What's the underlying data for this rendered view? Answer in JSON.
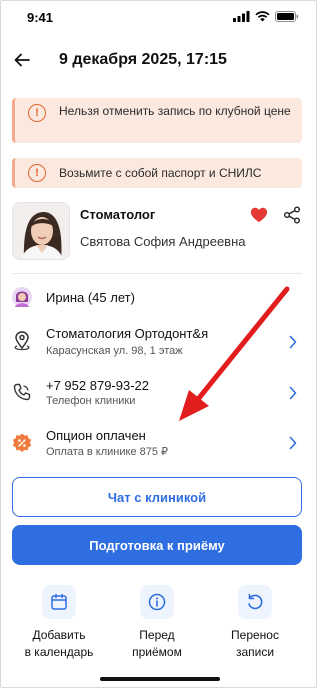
{
  "status_bar": {
    "time": "9:41"
  },
  "header": {
    "title": "9 декабря 2025, 17:15"
  },
  "notices": [
    {
      "text": "Нельзя отменить запись по клубной цене"
    },
    {
      "text": "Возьмите с собой паспорт и СНИЛС"
    }
  ],
  "doctor": {
    "specialty": "Стоматолог",
    "name": "Святова София Андреевна",
    "favorited": true
  },
  "patient": {
    "label": "Ирина (45 лет)"
  },
  "clinic": {
    "name": "Стоматология Ортодонт&я",
    "address": "Карасунская ул. 98, 1 этаж"
  },
  "phone": {
    "number": "+7 952 879-93-22",
    "caption": "Телефон клиники"
  },
  "option": {
    "title": "Опцион оплачен",
    "caption": "Оплата в клинике 875 ₽"
  },
  "buttons": {
    "chat": "Чат с клиникой",
    "prepare": "Подготовка к приёму"
  },
  "actions": [
    {
      "label": "Добавить\nв календарь",
      "icon": "calendar-icon"
    },
    {
      "label": "Перед\nприёмом",
      "icon": "info-icon"
    },
    {
      "label": "Перенос\nзаписи",
      "icon": "reschedule-icon"
    }
  ],
  "colors": {
    "accent": "#2f6ee0",
    "notice_bg": "#fbe8df",
    "notice_icon": "#e4652d",
    "heart": "#e53935",
    "annotation_arrow": "#e11d1d"
  }
}
